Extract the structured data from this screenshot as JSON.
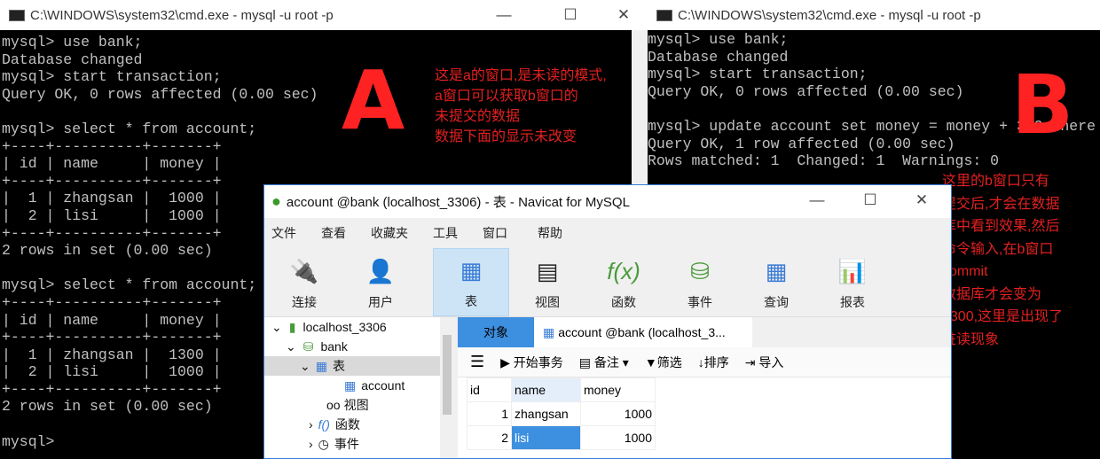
{
  "terminal_a": {
    "title": "C:\\WINDOWS\\system32\\cmd.exe - mysql  -u root -p",
    "label": "A",
    "lines": [
      "mysql> use bank;",
      "Database changed",
      "mysql> start transaction;",
      "Query OK, 0 rows affected (0.00 sec)",
      "",
      "mysql> select * from account;",
      "+----+----------+-------+",
      "| id | name     | money |",
      "+----+----------+-------+",
      "|  1 | zhangsan |  1000 |",
      "|  2 | lisi     |  1000 |",
      "+----+----------+-------+",
      "2 rows in set (0.00 sec)",
      "",
      "mysql> select * from account;",
      "+----+----------+-------+",
      "| id | name     | money |",
      "+----+----------+-------+",
      "|  1 | zhangsan |  1300 |",
      "|  2 | lisi     |  1000 |",
      "+----+----------+-------+",
      "2 rows in set (0.00 sec)",
      "",
      "mysql>"
    ],
    "note": "这是a的窗口,是未读的模式,\na窗口可以获取b窗口的\n未提交的数据\n数据下面的显示未改变"
  },
  "terminal_b": {
    "title": "C:\\WINDOWS\\system32\\cmd.exe - mysql  -u root -p",
    "label": "B",
    "lines": [
      "mysql> use bank;",
      "Database changed",
      "mysql> start transaction;",
      "Query OK, 0 rows affected (0.00 sec)",
      "",
      "mysql> update account set money = money + 300 where",
      "Query OK, 1 row affected (0.00 sec)",
      "Rows matched: 1  Changed: 1  Warnings: 0"
    ],
    "note": "这里的b窗口只有\n提交后,才会在数据\n库中看到效果,然后\n命令输入,在b窗口\ncommit\n数据库才会变为\n1300,这里是出现了\n脏读现象"
  },
  "navicat": {
    "title": "account @bank (localhost_3306) - 表 - Navicat for MySQL",
    "menu": [
      "文件",
      "查看",
      "收藏夹",
      "工具",
      "窗口",
      "帮助"
    ],
    "toolbar": [
      "连接",
      "用户",
      "表",
      "视图",
      "函数",
      "事件",
      "查询",
      "报表"
    ],
    "tree": [
      "localhost_3306",
      "bank",
      "表",
      "account",
      "视图",
      "函数",
      "事件"
    ],
    "tabs": [
      "对象",
      "account @bank (localhost_3..."
    ],
    "subtoolbar": [
      "开始事务",
      "备注",
      "筛选",
      "排序",
      "导入"
    ],
    "columns": [
      "id",
      "name",
      "money"
    ],
    "rows": [
      [
        "1",
        "zhangsan",
        "1000"
      ],
      [
        "2",
        "lisi",
        "1000"
      ]
    ]
  }
}
